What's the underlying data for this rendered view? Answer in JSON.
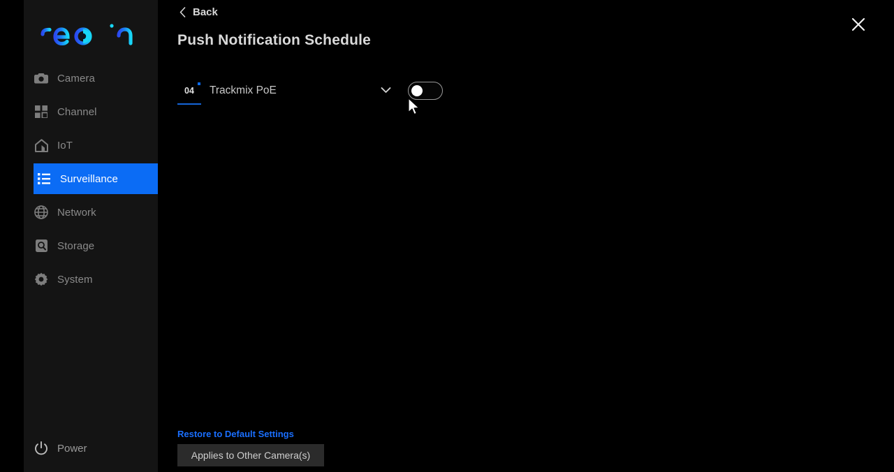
{
  "app": {
    "brand": "reolink",
    "brand_colors": {
      "start": "#2b49f0",
      "mid": "#1b7ef5",
      "end": "#18d7f7"
    },
    "accent": "#0b6cf5",
    "background": "#000000",
    "sidebar_background": "#141414"
  },
  "sidebar": {
    "items": [
      {
        "label": "Camera",
        "icon": "camera-icon",
        "active": false
      },
      {
        "label": "Channel",
        "icon": "grid-icon",
        "active": false
      },
      {
        "label": "IoT",
        "icon": "home-icon",
        "active": false
      },
      {
        "label": "Surveillance",
        "icon": "list-icon",
        "active": true
      },
      {
        "label": "Network",
        "icon": "globe-icon",
        "active": false
      },
      {
        "label": "Storage",
        "icon": "hard-drive-icon",
        "active": false
      },
      {
        "label": "System",
        "icon": "gear-icon",
        "active": false
      }
    ],
    "power": {
      "label": "Power",
      "icon": "power-icon"
    }
  },
  "header": {
    "back_label": "Back",
    "back_icon": "chevron-left-icon",
    "title": "Push Notification Schedule",
    "close_icon": "close-icon"
  },
  "camera_selector": {
    "channel_number": "04",
    "camera_name": "Trackmix PoE",
    "dropdown_icon": "chevron-down-icon",
    "has_badge_dot": true
  },
  "push_toggle": {
    "state": "off",
    "name": "push-notification-toggle"
  },
  "footer": {
    "restore_label": "Restore to Default Settings",
    "applies_label": "Applies to Other Camera(s)"
  }
}
